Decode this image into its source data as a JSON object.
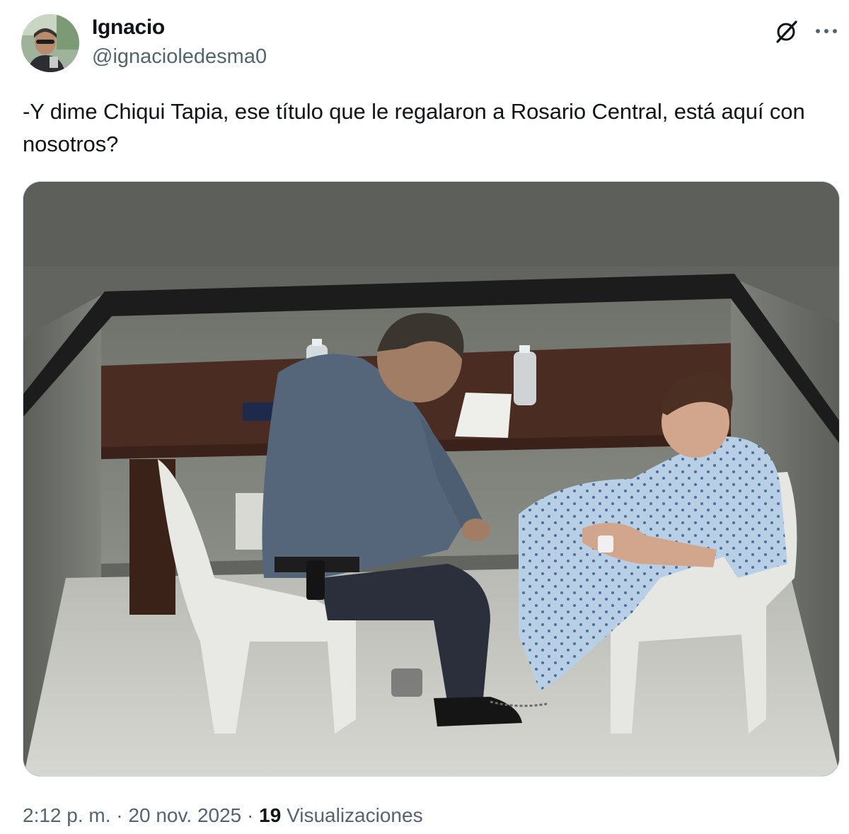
{
  "author": {
    "display_name": "Ignacio",
    "handle": "@ignacioledesma0"
  },
  "icons": {
    "grok": "grok-icon",
    "more": "more-options-icon"
  },
  "tweet": {
    "text": "-Y dime Chiqui Tapia, ese título que le regalaron a Rosario Central, está aquí con nosotros?"
  },
  "meta": {
    "time": "2:12 p. m.",
    "separator": "·",
    "date": "20 nov. 2025",
    "views_count": "19",
    "views_label": "Visualizaciones"
  },
  "colors": {
    "text_primary": "#0f1419",
    "text_secondary": "#536471",
    "border": "#cfd9de"
  }
}
